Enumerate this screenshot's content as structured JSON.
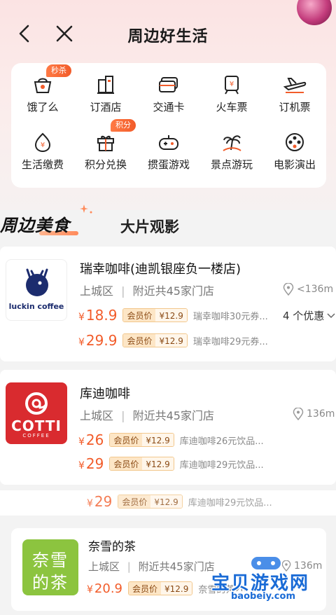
{
  "header": {
    "title": "周边好生活",
    "back_icon": "back-chevron-icon",
    "close_icon": "close-icon"
  },
  "colors": {
    "accent": "#f25c2a",
    "tag": "#ff7a45",
    "member_bg": "#fde6c6",
    "luckin": "#1c2c6e",
    "cotti": "#d92b2f",
    "naixue": "#8cc43f"
  },
  "services": [
    {
      "label": "饿了么",
      "icon": "food-basket-icon",
      "tag": "秒杀"
    },
    {
      "label": "订酒店",
      "icon": "hotel-building-icon",
      "tag": ""
    },
    {
      "label": "交通卡",
      "icon": "transit-card-icon",
      "tag": ""
    },
    {
      "label": "火车票",
      "icon": "train-ticket-icon",
      "tag": ""
    },
    {
      "label": "订机票",
      "icon": "airplane-icon",
      "tag": ""
    },
    {
      "label": "生活缴费",
      "icon": "utility-payment-icon",
      "tag": ""
    },
    {
      "label": "积分兑换",
      "icon": "gift-icon",
      "tag": "积分"
    },
    {
      "label": "掼蛋游戏",
      "icon": "gamepad-icon",
      "tag": ""
    },
    {
      "label": "景点游玩",
      "icon": "palm-island-icon",
      "tag": ""
    },
    {
      "label": "电影演出",
      "icon": "film-reel-icon",
      "tag": ""
    }
  ],
  "tabs": {
    "food": "周边美食",
    "movie": "大片观影"
  },
  "stores": [
    {
      "name": "瑞幸咖啡(迪凯银座负一楼店)",
      "logo_text": "luckin coffee",
      "district": "上城区",
      "nearby": "附近共45家门店",
      "distance": "<136m",
      "offers": "4 个优惠",
      "deals": [
        {
          "price": "18.9",
          "member_label": "会员价",
          "member_price": "¥12.9",
          "coupon": "瑞幸咖啡30元券..."
        },
        {
          "price": "29.9",
          "member_label": "会员价",
          "member_price": "¥12.9",
          "coupon": "瑞幸咖啡29元券..."
        }
      ]
    },
    {
      "name": "库迪咖啡",
      "logo_text": "COTTI",
      "logo_sub": "COFFEE",
      "district": "上城区",
      "nearby": "附近共45家门店",
      "distance": "136m",
      "deals": [
        {
          "price": "26",
          "member_label": "会员价",
          "member_price": "¥12.9",
          "coupon": "库迪咖啡26元饮品..."
        },
        {
          "price": "29",
          "member_label": "会员价",
          "member_price": "¥12.9",
          "coupon": "库迪咖啡29元饮品..."
        }
      ]
    },
    {
      "name": "奈雪的茶",
      "logo_text_1": "奈雪",
      "logo_text_2": "的茶",
      "district": "上城区",
      "nearby": "附近共45家门店",
      "distance": "136m",
      "deals": [
        {
          "price": "20.9",
          "member_label": "会员价",
          "member_price": "¥12.9",
          "coupon": "奈雪的茶20..."
        }
      ]
    }
  ],
  "partial_row": {
    "price": "29",
    "member_label": "会员价",
    "member_price": "¥12.9",
    "coupon": "库迪咖啡29元饮品..."
  },
  "watermark": {
    "text": "宝贝游戏网",
    "url": "baobeiy.com"
  },
  "yen": "¥"
}
